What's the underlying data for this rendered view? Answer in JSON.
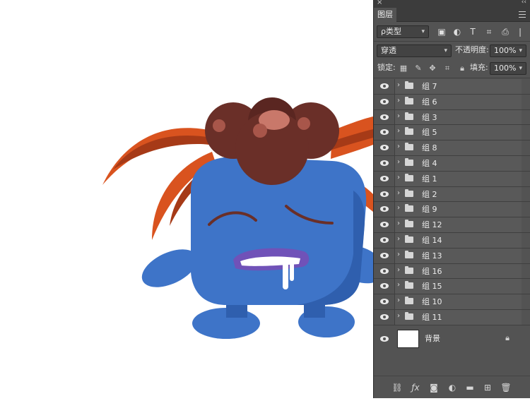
{
  "panel": {
    "close_glyph": "×",
    "collapse_glyph": "‹‹",
    "tab_label": "图层",
    "filter_kind": "ρ类型",
    "blend_mode": "穿透",
    "opacity_label": "不透明度:",
    "opacity_value": "100%",
    "lock_label": "锁定:",
    "fill_label": "填充:",
    "fill_value": "100%"
  },
  "layers": [
    {
      "name": "组 7"
    },
    {
      "name": "组 6"
    },
    {
      "name": "组 3"
    },
    {
      "name": "组 5"
    },
    {
      "name": "组 8"
    },
    {
      "name": "组 4"
    },
    {
      "name": "组 1"
    },
    {
      "name": "组 2"
    },
    {
      "name": "组 9"
    },
    {
      "name": "组 12"
    },
    {
      "name": "组 14"
    },
    {
      "name": "组 13"
    },
    {
      "name": "组 16"
    },
    {
      "name": "组 15"
    },
    {
      "name": "组 10"
    },
    {
      "name": "组 11"
    }
  ],
  "background_layer": {
    "name": "背景"
  },
  "colors": {
    "panel_bg": "#535353",
    "creature_blue": "#3e74c8",
    "leaf_orange": "#d9531f",
    "flower_brown": "#6a2f28"
  }
}
